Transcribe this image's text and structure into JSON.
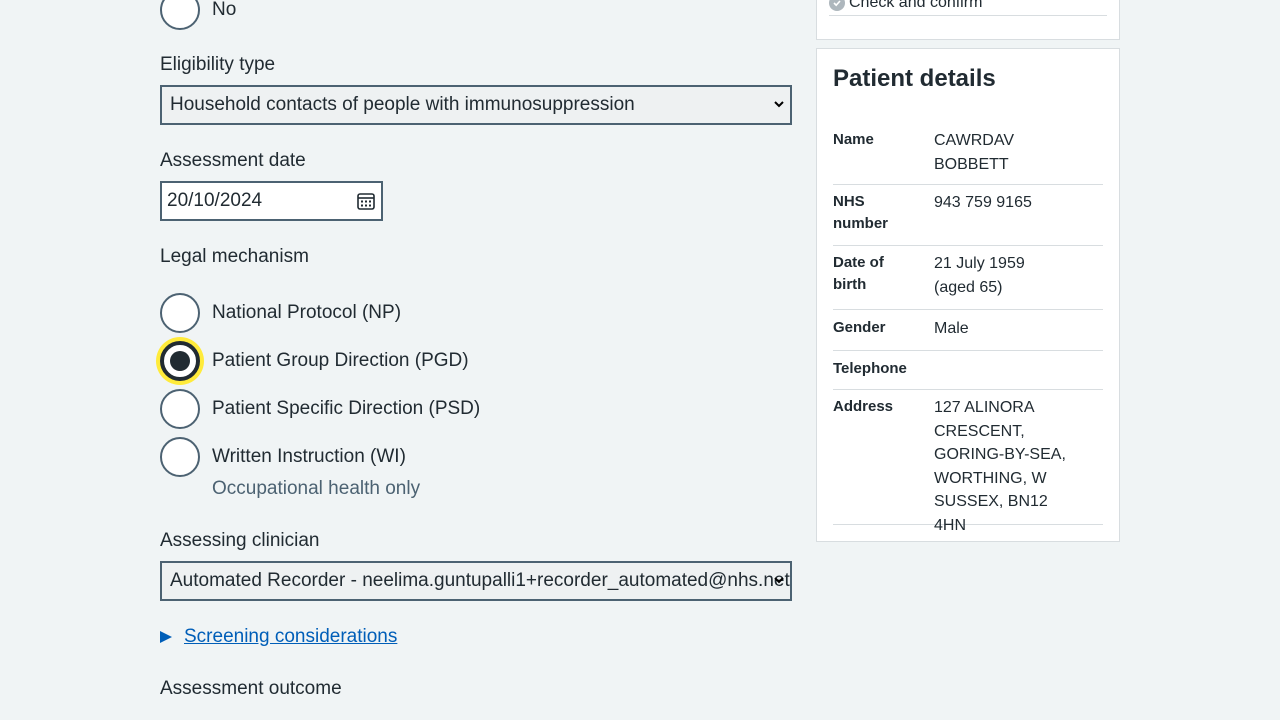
{
  "form": {
    "prev_option_no": "No",
    "eligibility": {
      "label": "Eligibility type",
      "selected": "Household contacts of people with immunosuppression"
    },
    "assessment_date": {
      "label": "Assessment date",
      "value": "20/10/2024"
    },
    "legal_mechanism": {
      "label": "Legal mechanism",
      "options": [
        "National Protocol (NP)",
        "Patient Group Direction (PGD)",
        "Patient Specific Direction (PSD)",
        "Written Instruction (WI)"
      ],
      "selected_index": 1,
      "wi_hint": "Occupational health only"
    },
    "assessing_clinician": {
      "label": "Assessing clinician",
      "selected": "Automated Recorder - neelima.guntupalli1+recorder_automated@nhs.net"
    },
    "screening_link": "Screening considerations",
    "assessment_outcome_label": "Assessment outcome"
  },
  "sidebar": {
    "task_item": "Check and confirm",
    "patient": {
      "title": "Patient details",
      "name_key": "Name",
      "name_val": "CAWRDAV BOBBETT",
      "nhs_key": "NHS number",
      "nhs_val": "943 759 9165",
      "dob_key": "Date of birth",
      "dob_val": "21 July 1959 (aged 65)",
      "gender_key": "Gender",
      "gender_val": "Male",
      "tel_key": "Telephone",
      "tel_val": "",
      "addr_key": "Address",
      "addr_val": "127 ALINORA CRESCENT, GORING-BY-SEA, WORTHING, W SUSSEX, BN12 4HN"
    }
  },
  "colors": {
    "link": "#005eb8",
    "focus": "#ffeb3b",
    "text": "#212b32",
    "border": "#4c6272"
  }
}
